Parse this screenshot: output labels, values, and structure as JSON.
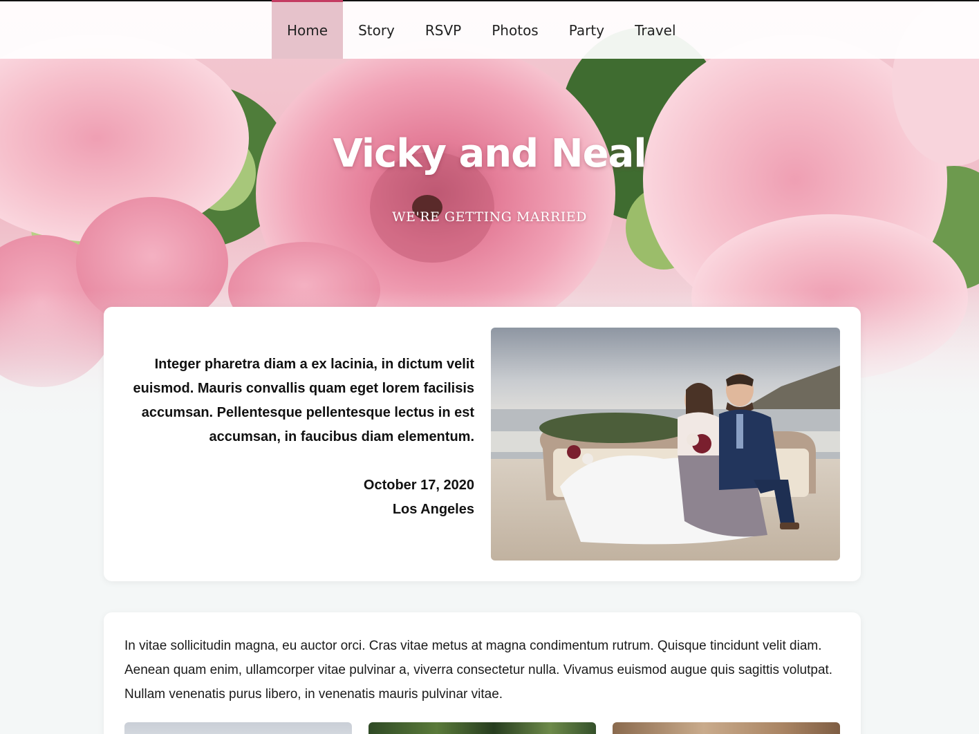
{
  "nav": {
    "items": [
      {
        "label": "Home",
        "active": true
      },
      {
        "label": "Story",
        "active": false
      },
      {
        "label": "RSVP",
        "active": false
      },
      {
        "label": "Photos",
        "active": false
      },
      {
        "label": "Party",
        "active": false
      },
      {
        "label": "Travel",
        "active": false
      }
    ]
  },
  "hero": {
    "title": "Vicky and Neal",
    "subtitle": "WE'RE GETTING MARRIED"
  },
  "intro": {
    "text": "Integer pharetra diam a ex lacinia, in dictum velit euismod. Mauris convallis quam eget lorem facilisis accumsan. Pellentesque pellentesque lectus in est accumsan, in faucibus diam elementum.",
    "date": "October 17, 2020",
    "location": "Los Angeles"
  },
  "about": {
    "text": "In vitae sollicitudin magna, eu auctor orci. Cras vitae metus at magna condimentum rutrum. Quisque tincidunt velit diam. Aenean quam enim, ullamcorper vitae pulvinar a, viverra consectetur nulla. Vivamus euismod augue quis sagittis volutpat. Nullam venenatis purus libero, in venenatis mauris pulvinar vitae."
  },
  "colors": {
    "accent": "#c43b62",
    "nav_active_bg": "#e6c2cb",
    "page_bg": "#f4f7f7"
  }
}
